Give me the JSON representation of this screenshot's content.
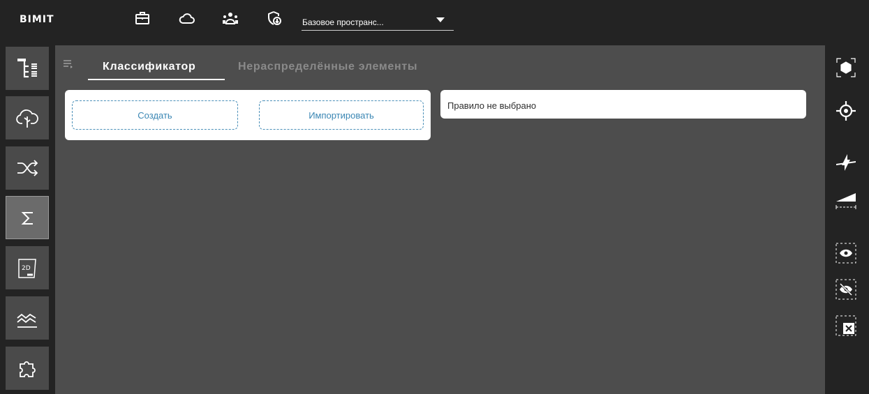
{
  "app": {
    "logo_text": "BIMIT"
  },
  "topbar": {
    "icons": [
      "briefcase-icon",
      "cloud-icon",
      "users-icon",
      "shield-download-icon"
    ],
    "space_select": {
      "value": "Базовое пространс...",
      "caret": "caret-down-icon"
    }
  },
  "leftbar": {
    "items": [
      {
        "name": "tree-structure",
        "icon": "tree-structure-icon",
        "active": false
      },
      {
        "name": "cloud-tree",
        "icon": "cloud-tree-icon",
        "active": false
      },
      {
        "name": "shuffle",
        "icon": "shuffle-icon",
        "active": false
      },
      {
        "name": "sum",
        "icon": "sigma-icon",
        "active": true
      },
      {
        "name": "2d-view",
        "icon": "2d-sheet-icon",
        "active": false
      },
      {
        "name": "chart-lines",
        "icon": "chart-lines-icon",
        "active": false
      },
      {
        "name": "plugins",
        "icon": "puzzle-icon",
        "active": false
      }
    ]
  },
  "main": {
    "tabs": [
      {
        "label": "Классификатор",
        "active": true
      },
      {
        "label": "Нераспределённые элементы",
        "active": false
      }
    ],
    "actions": {
      "create_label": "Создать",
      "import_label": "Импортировать"
    },
    "rule_status": "Правило не выбрано"
  },
  "rightbar": {
    "icons": [
      "focus-frame-icon",
      "target-icon",
      "section-plane-icon",
      "ruler-icon",
      "show-icon",
      "hide-icon",
      "clear-icon"
    ]
  },
  "colors": {
    "background": "#232323",
    "panel": "#4d4d4d",
    "button_dark": "#4a4a4a",
    "button_active": "#6b6b6b",
    "accent_blue": "#3b87b4",
    "text_light": "#ffffff",
    "text_muted": "#8a8a8a"
  }
}
